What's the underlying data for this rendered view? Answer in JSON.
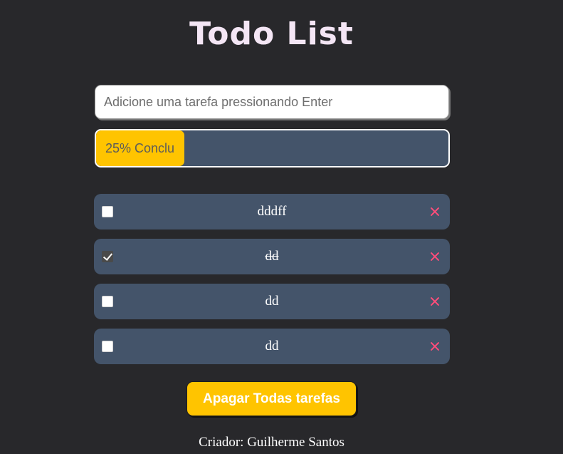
{
  "header": {
    "title": "Todo List"
  },
  "input": {
    "placeholder": "Adicione uma tarefa pressionando Enter",
    "value": ""
  },
  "progress": {
    "percent": 25,
    "label": "25% Conclu"
  },
  "tasks": [
    {
      "text": "dddff",
      "done": false
    },
    {
      "text": "dd",
      "done": true
    },
    {
      "text": "dd",
      "done": false
    },
    {
      "text": "dd",
      "done": false
    }
  ],
  "actions": {
    "clear_all_label": "Apagar Todas tarefas"
  },
  "footer": {
    "credit": "Criador: Guilherme Santos"
  },
  "colors": {
    "background": "#28282b",
    "item_background": "#44546a",
    "accent": "#ffc400",
    "delete": "#ff4d7a",
    "title": "#f4e6f5"
  },
  "icons": {
    "delete": "close-icon",
    "check": "checkmark-icon"
  }
}
